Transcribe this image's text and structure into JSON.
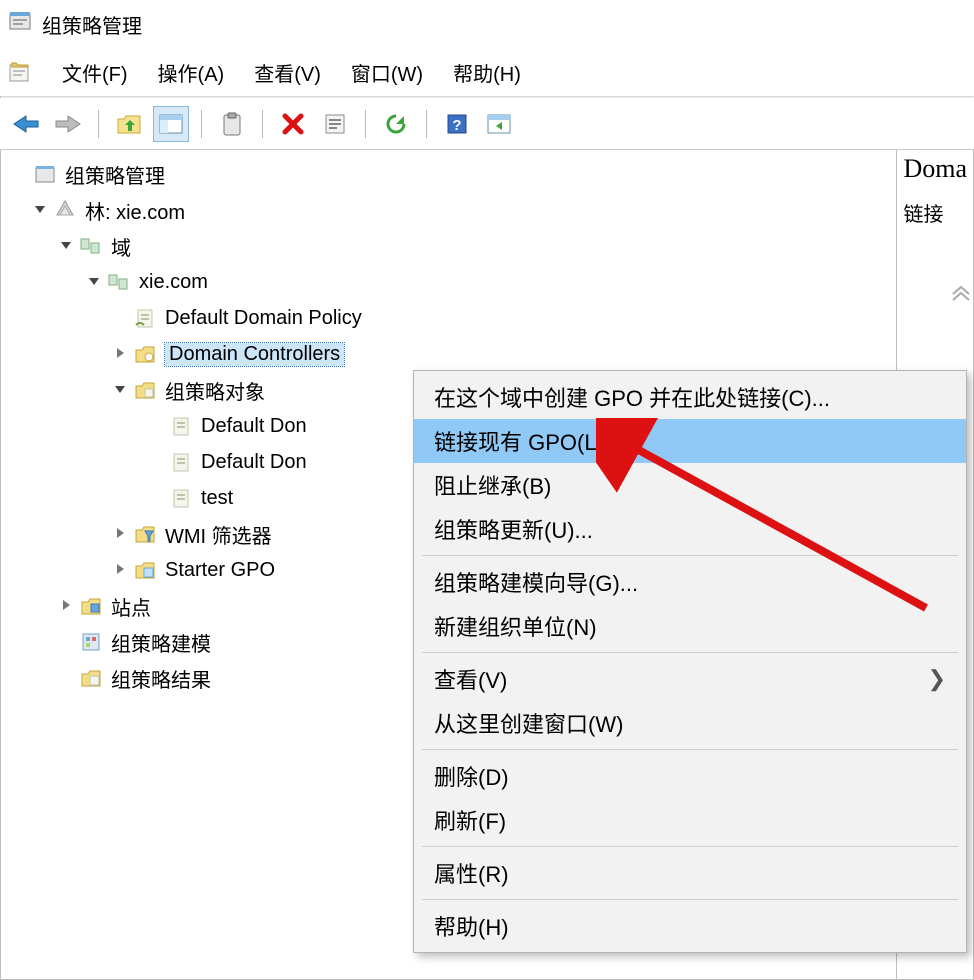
{
  "title": "组策略管理",
  "menu": {
    "file": "文件(F)",
    "action": "操作(A)",
    "view": "查看(V)",
    "window": "窗口(W)",
    "help": "帮助(H)"
  },
  "tree": {
    "root": "组策略管理",
    "forest": "林: xie.com",
    "domains": "域",
    "domain": "xie.com",
    "dd_policy": "Default Domain Policy",
    "dcs": "Domain Controllers",
    "gpo_objects": "组策略对象",
    "gpo1": "Default Don",
    "gpo2": "Default Don",
    "gpo3": "test",
    "wmi": "WMI 筛选器",
    "starter": "Starter GPO",
    "sites": "站点",
    "modeling": "组策略建模",
    "results": "组策略结果"
  },
  "detail": {
    "title": "Doma",
    "subtitle": "链接"
  },
  "contextMenu": {
    "createGpo": "在这个域中创建 GPO 并在此处链接(C)...",
    "linkGpo": "链接现有 GPO(L)...",
    "blockInh": "阻止继承(B)",
    "gpUpdate": "组策略更新(U)...",
    "modelWiz": "组策略建模向导(G)...",
    "newOU": "新建组织单位(N)",
    "view": "查看(V)",
    "newWin": "从这里创建窗口(W)",
    "delete": "删除(D)",
    "refresh": "刷新(F)",
    "props": "属性(R)",
    "help": "帮助(H)"
  }
}
